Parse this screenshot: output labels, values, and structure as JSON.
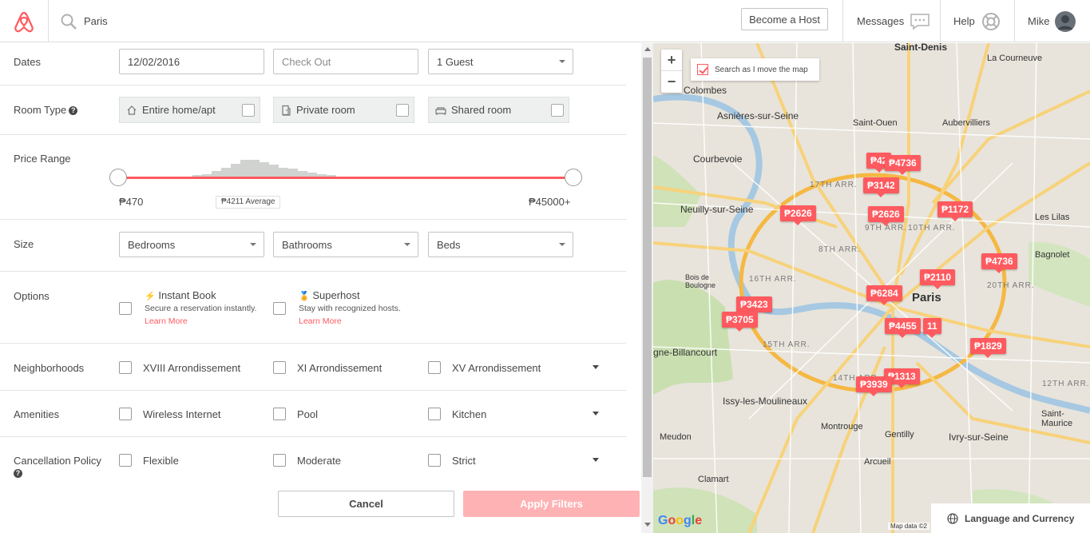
{
  "header": {
    "search_query": "Paris",
    "become_host": "Become a Host",
    "messages": "Messages",
    "help": "Help",
    "user_name": "Mike"
  },
  "filters": {
    "dates": {
      "label": "Dates",
      "check_in": "12/02/2016",
      "check_out_placeholder": "Check Out",
      "guests": "1 Guest"
    },
    "room_type": {
      "label": "Room Type",
      "options": [
        "Entire home/apt",
        "Private room",
        "Shared room"
      ]
    },
    "price_range": {
      "label": "Price Range",
      "min": "₱470",
      "max": "₱45000+",
      "average": "₱4211 Average",
      "histogram": [
        1,
        1,
        2,
        3,
        4,
        6,
        9,
        12,
        15,
        15,
        13,
        11,
        9,
        8,
        6,
        5,
        4,
        3,
        2,
        2,
        2,
        1,
        1
      ]
    },
    "size": {
      "label": "Size",
      "bedrooms": "Bedrooms",
      "bathrooms": "Bathrooms",
      "beds": "Beds"
    },
    "options": {
      "label": "Options",
      "instant_book": {
        "title": "Instant Book",
        "desc": "Secure a reservation instantly.",
        "link": "Learn More"
      },
      "superhost": {
        "title": "Superhost",
        "desc": "Stay with recognized hosts.",
        "link": "Learn More"
      }
    },
    "neighborhoods": {
      "label": "Neighborhoods",
      "items": [
        "XVIII Arrondissement",
        "XI Arrondissement",
        "XV Arrondissement"
      ]
    },
    "amenities": {
      "label": "Amenities",
      "items": [
        "Wireless Internet",
        "Pool",
        "Kitchen"
      ]
    },
    "cancellation": {
      "label": "Cancellation Policy",
      "items": [
        "Flexible",
        "Moderate",
        "Strict"
      ]
    },
    "cancel_button": "Cancel",
    "apply_button": "Apply Filters"
  },
  "map": {
    "search_as_move": "Search as I move the map",
    "language_currency": "Language and Currency",
    "map_data": "Map data ©2",
    "google": "Google",
    "places": [
      "Saint-Denis",
      "La Courneuve",
      "Colombes",
      "Asnières-sur-Seine",
      "Saint-Ouen",
      "Aubervilliers",
      "Courbevoie",
      "Neuilly-sur-Seine",
      "17TH ARR.",
      "9TH ARR.",
      "10TH ARR.",
      "8TH ARR.",
      "Les Lilas",
      "Bagnolet",
      "16TH ARR.",
      "Paris",
      "20TH ARR.",
      "gne-Billancourt",
      "15TH ARR.",
      "14TH ARR.",
      "12TH ARR.",
      "Issy-les-Moulineaux",
      "Meudon",
      "Montrouge",
      "Gentilly",
      "Ivry-sur-Seine",
      "Saint-Maurice",
      "Clamart",
      "Arcueil",
      "Bois de Boulogne"
    ],
    "pins": [
      "₱42",
      "₱4736",
      "₱3142",
      "₱2626",
      "₱2626",
      "₱1172",
      "₱4736",
      "₱2110",
      "₱6284",
      "₱3423",
      "₱3705",
      "₱4455",
      "11",
      "₱1829",
      "₱1313",
      "₱3939"
    ]
  },
  "colors": {
    "brand": "#ff5a5f",
    "apply_disabled": "#ffb2b4"
  }
}
